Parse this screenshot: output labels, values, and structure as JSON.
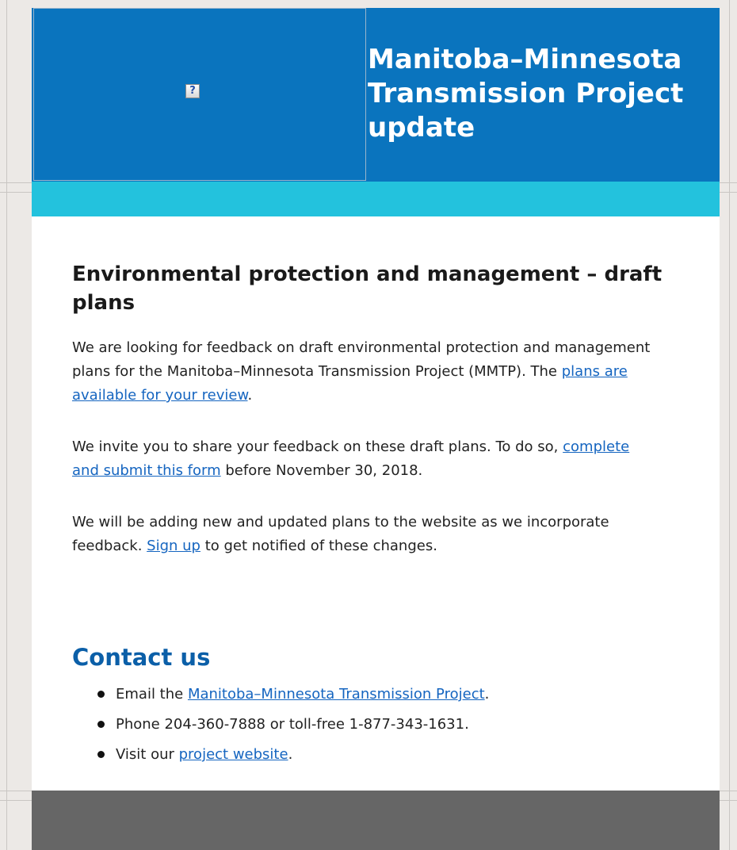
{
  "header": {
    "logo_glyph": "?",
    "title": "Manitoba–Minnesota Transmission Project update",
    "background_color": "#0a74be",
    "band_color": "#23c2dd"
  },
  "content": {
    "heading": "Environmental protection and management – draft plans",
    "para1": {
      "before_link": "We are looking for feedback on draft environmental protection and management plans for the Manitoba–Minnesota Transmission Project (MMTP). The ",
      "link": "plans are available for your review",
      "after_link": "."
    },
    "para2": {
      "before_link": "We invite you to share your feedback on these draft plans. To do so, ",
      "link": "complete and submit this form",
      "after_link": " before November 30, 2018."
    },
    "para3": {
      "before_link": "We will be adding new and updated plans to the website as we incorporate feedback. ",
      "link": "Sign up",
      "after_link": " to get notified of these changes."
    }
  },
  "contact": {
    "heading": "Contact us",
    "items": [
      {
        "before_link": "Email the ",
        "link": "Manitoba–Minnesota Transmission Project",
        "after_link": "."
      },
      {
        "text": "Phone 204-360-7888 or toll-free 1-877-343-1631."
      },
      {
        "before_link": "Visit our ",
        "link": "project website",
        "after_link": "."
      }
    ]
  },
  "footer": {
    "background_color": "#666666"
  }
}
